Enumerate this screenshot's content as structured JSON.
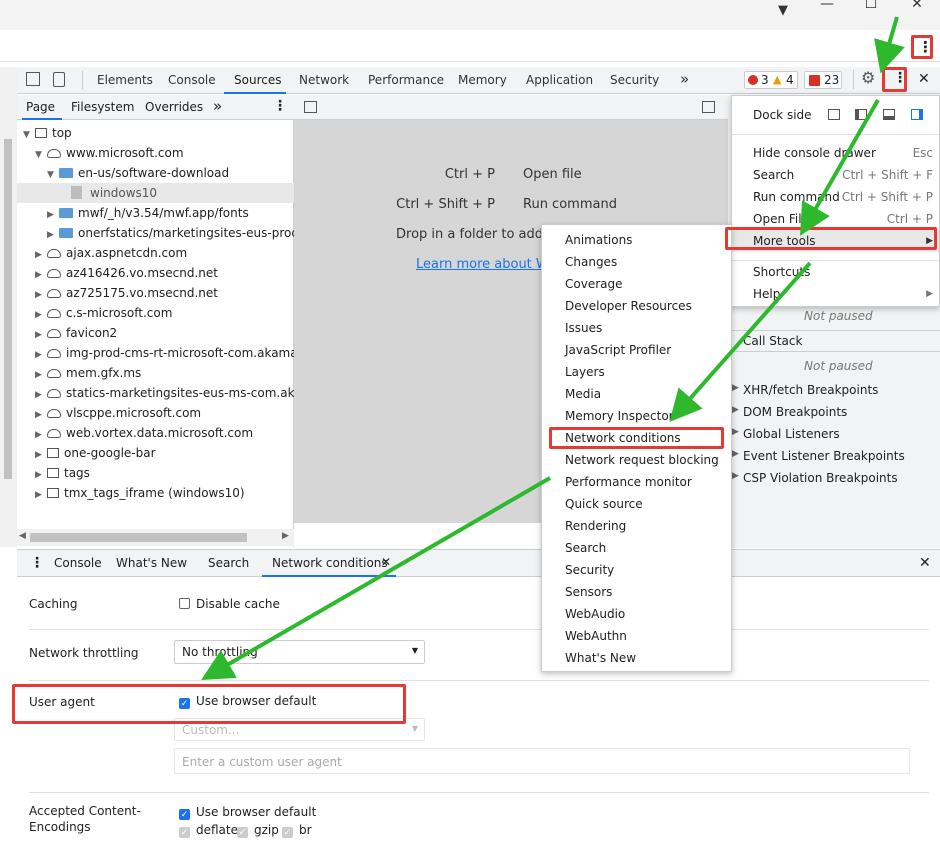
{
  "window": {
    "close": "✕",
    "maximize": "☐",
    "minimize": "—",
    "profile": "▼",
    "kebab": "⋮"
  },
  "devtools": {
    "tabs": [
      "Elements",
      "Console",
      "Sources",
      "Network",
      "Performance",
      "Memory",
      "Application",
      "Security"
    ],
    "more_tabs": "»",
    "badges": {
      "errors": "3",
      "warnings": "4",
      "issues": "23"
    },
    "close": "✕"
  },
  "navigator": {
    "tabs": [
      "Page",
      "Filesystem",
      "Overrides"
    ],
    "more": "»",
    "tree": [
      {
        "label": "top",
        "indent": 0,
        "icon": "frame",
        "tri": "▼"
      },
      {
        "label": "www.microsoft.com",
        "indent": 1,
        "icon": "cloud",
        "tri": "▼"
      },
      {
        "label": "en-us/software-download",
        "indent": 2,
        "icon": "folder",
        "tri": "▼"
      },
      {
        "label": "windows10",
        "indent": 3,
        "icon": "file",
        "tri": ""
      },
      {
        "label": "mwf/_h/v3.54/mwf.app/fonts",
        "indent": 2,
        "icon": "folder",
        "tri": "▶"
      },
      {
        "label": "onerfstatics/marketingsites-eus-prod",
        "indent": 2,
        "icon": "folder",
        "tri": "▶"
      },
      {
        "label": "ajax.aspnetcdn.com",
        "indent": 1,
        "icon": "cloud",
        "tri": "▶"
      },
      {
        "label": "az416426.vo.msecnd.net",
        "indent": 1,
        "icon": "cloud",
        "tri": "▶"
      },
      {
        "label": "az725175.vo.msecnd.net",
        "indent": 1,
        "icon": "cloud",
        "tri": "▶"
      },
      {
        "label": "c.s-microsoft.com",
        "indent": 1,
        "icon": "cloud",
        "tri": "▶"
      },
      {
        "label": "favicon2",
        "indent": 1,
        "icon": "cloud",
        "tri": "▶"
      },
      {
        "label": "img-prod-cms-rt-microsoft-com.akamaized",
        "indent": 1,
        "icon": "cloud",
        "tri": "▶"
      },
      {
        "label": "mem.gfx.ms",
        "indent": 1,
        "icon": "cloud",
        "tri": "▶"
      },
      {
        "label": "statics-marketingsites-eus-ms-com.akamai",
        "indent": 1,
        "icon": "cloud",
        "tri": "▶"
      },
      {
        "label": "vlscppe.microsoft.com",
        "indent": 1,
        "icon": "cloud",
        "tri": "▶"
      },
      {
        "label": "web.vortex.data.microsoft.com",
        "indent": 1,
        "icon": "cloud",
        "tri": "▶"
      },
      {
        "label": "one-google-bar",
        "indent": 1,
        "icon": "frame",
        "tri": "▶"
      },
      {
        "label": "tags",
        "indent": 1,
        "icon": "frame",
        "tri": "▶"
      },
      {
        "label": "tmx_tags_iframe (windows10)",
        "indent": 1,
        "icon": "frame",
        "tri": "▶"
      }
    ]
  },
  "editor": {
    "shortcuts": [
      {
        "keys": "Ctrl + P",
        "action": "Open file"
      },
      {
        "keys": "Ctrl + Shift + P",
        "action": "Run command"
      }
    ],
    "drop_text": "Drop in a folder to add",
    "learn_more": "Learn more about W"
  },
  "sidebar": {
    "not_paused_1": "Not paused",
    "call_stack": "Call Stack",
    "not_paused_2": "Not paused",
    "sections": [
      "XHR/fetch Breakpoints",
      "DOM Breakpoints",
      "Global Listeners",
      "Event Listener Breakpoints",
      "CSP Violation Breakpoints"
    ]
  },
  "main_menu": {
    "dock_side": "Dock side",
    "items": [
      {
        "label": "Hide console drawer",
        "shortcut": "Esc"
      },
      {
        "label": "Search",
        "shortcut": "Ctrl + Shift + F"
      },
      {
        "label": "Run command",
        "shortcut": "Ctrl + Shift + P"
      },
      {
        "label": "Open File",
        "shortcut": "Ctrl + P"
      },
      {
        "label": "More tools",
        "shortcut": "▶"
      }
    ],
    "shortcuts": "Shortcuts",
    "help": "Help",
    "help_arrow": "▶"
  },
  "submenu": [
    "Animations",
    "Changes",
    "Coverage",
    "Developer Resources",
    "Issues",
    "JavaScript Profiler",
    "Layers",
    "Media",
    "Memory Inspector",
    "Network conditions",
    "Network request blocking",
    "Performance monitor",
    "Quick source",
    "Rendering",
    "Search",
    "Security",
    "Sensors",
    "WebAudio",
    "WebAuthn",
    "What's New"
  ],
  "drawer": {
    "tabs": [
      "Console",
      "What's New",
      "Search",
      "Network conditions"
    ],
    "tab_close": "✕",
    "close": "✕",
    "caching_label": "Caching",
    "disable_cache": "Disable cache",
    "throttling_label": "Network throttling",
    "throttling_value": "No throttling",
    "user_agent_label": "User agent",
    "use_browser_default": "Use browser default",
    "custom_select": "Custom...",
    "custom_placeholder": "Enter a custom user agent",
    "accepted_label_1": "Accepted Content-",
    "accepted_label_2": "Encodings",
    "accepted_default": "Use browser default",
    "encodings": [
      "deflate",
      "gzip",
      "br"
    ]
  },
  "colors": {
    "accent": "#1a73e8",
    "annotation_red": "#e53935",
    "arrow_green": "#2eb82e"
  }
}
